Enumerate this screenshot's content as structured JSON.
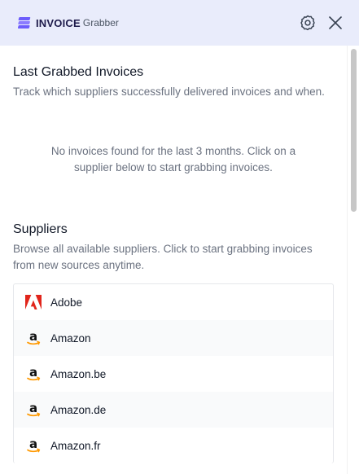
{
  "brand": {
    "name_strong": "INVOICE",
    "name_light": "Grabber"
  },
  "header": {
    "settings_icon": "gear-icon",
    "close_icon": "close-icon"
  },
  "last_grabbed": {
    "title": "Last Grabbed Invoices",
    "description": "Track which suppliers successfully delivered invoices and when.",
    "empty_message": "No invoices found for the last 3 months. Click on a supplier below to start grabbing invoices."
  },
  "suppliers": {
    "title": "Suppliers",
    "description": "Browse all available suppliers. Click to start grabbing invoices from new sources anytime.",
    "items": [
      {
        "label": "Adobe",
        "icon": "adobe-icon"
      },
      {
        "label": "Amazon",
        "icon": "amazon-icon"
      },
      {
        "label": "Amazon.be",
        "icon": "amazon-icon"
      },
      {
        "label": "Amazon.de",
        "icon": "amazon-icon"
      },
      {
        "label": "Amazon.fr",
        "icon": "amazon-icon"
      }
    ]
  },
  "colors": {
    "header_bg": "#e9ecfb",
    "brand_purple": "#6d5dfc",
    "adobe_red": "#e1251b",
    "amazon_orange": "#ff9900"
  }
}
